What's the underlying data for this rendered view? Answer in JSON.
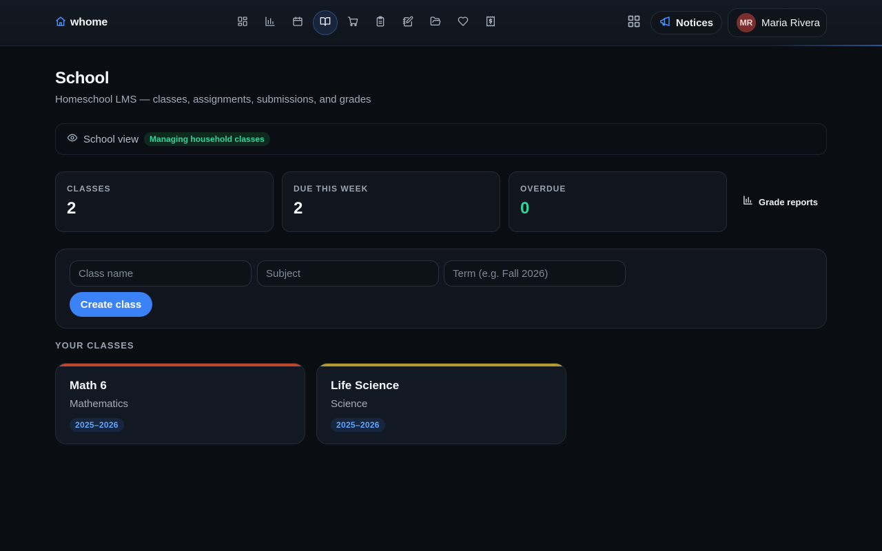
{
  "header": {
    "brand": "whome",
    "nav": [
      {
        "name": "dashboard-icon",
        "active": false
      },
      {
        "name": "chart-icon",
        "active": false
      },
      {
        "name": "calendar-icon",
        "active": false
      },
      {
        "name": "book-open-icon",
        "active": true
      },
      {
        "name": "cart-icon",
        "active": false
      },
      {
        "name": "clipboard-icon",
        "active": false
      },
      {
        "name": "notebook-pen-icon",
        "active": false
      },
      {
        "name": "folder-open-icon",
        "active": false
      },
      {
        "name": "heart-icon",
        "active": false
      },
      {
        "name": "receipt-dollar-icon",
        "active": false
      }
    ],
    "notices_label": "Notices",
    "user": {
      "initials": "MR",
      "name": "Maria Rivera"
    }
  },
  "page": {
    "title": "School",
    "subtitle": "Homeschool LMS — classes, assignments, submissions, and grades"
  },
  "view": {
    "label": "School view",
    "badge": "Managing household classes"
  },
  "stats": [
    {
      "label": "CLASSES",
      "value": "2"
    },
    {
      "label": "DUE THIS WEEK",
      "value": "2"
    },
    {
      "label": "OVERDUE",
      "value": "0"
    }
  ],
  "reports_label": "Grade reports",
  "form": {
    "class_name_placeholder": "Class name",
    "subject_placeholder": "Subject",
    "term_placeholder": "Term (e.g. Fall 2026)",
    "create_label": "Create class"
  },
  "classes_section_label": "YOUR CLASSES",
  "classes": [
    {
      "name": "Math 6",
      "subject": "Mathematics",
      "term": "2025–2026",
      "color": "#c2452d"
    },
    {
      "name": "Life Science",
      "subject": "Science",
      "term": "2025–2026",
      "color": "#b59a2e"
    }
  ],
  "colors": {
    "accent": "#3b82f6",
    "success": "#34d399",
    "background": "#0a0d12"
  }
}
